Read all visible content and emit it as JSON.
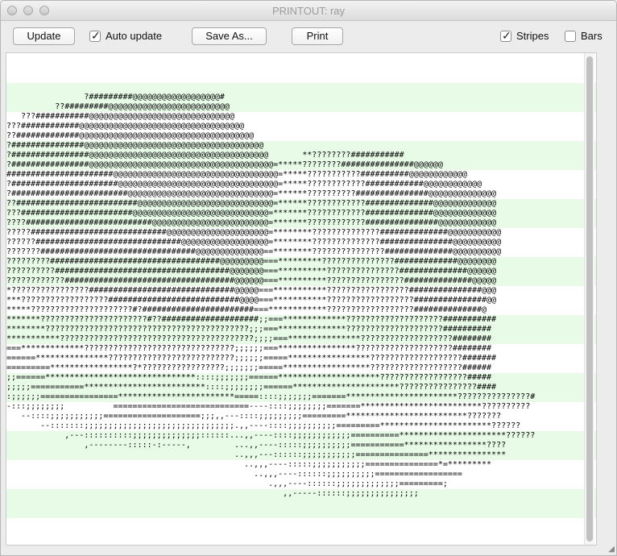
{
  "window": {
    "title": "PRINTOUT: ray"
  },
  "toolbar": {
    "update_label": "Update",
    "auto_update_label": "Auto update",
    "auto_update_checked": true,
    "save_as_label": "Save As...",
    "print_label": "Print",
    "stripes_label": "Stripes",
    "stripes_checked": true,
    "bars_label": "Bars",
    "bars_checked": false
  },
  "printout": {
    "lines": [
      "                ?#########@@@@@@@@@@@@@@@@@@#",
      "          ??#########@@@@@@@@@@@@@@@@@@@@@@@@@",
      "   ???###########@@@@@@@@@@@@@@@@@@@@@@@@@@@@@@",
      "???############@@@@@@@@@@@@@@@@@@@@@@@@@@@@@@@@@@",
      "??#############@@@@@@@@@@@@@@@@@@@@@@@@@@@@@@@@@@@@",
      "?###############@@@@@@@@@@@@@@@@@@@@@@@@@@@@@@@@@@@@@",
      "?################@@@@@@@@@@@@@@@@@@@@@@@@@@@@@@@@@@@@@       **????????###########",
      "?################@@@@@@@@@@@@@@@@@@@@@@@@@@@@@@@@@@@@@@=*****????????###############@@@@@@",
      "######################@@@@@@@@@@@@@@@@@@@@@@@@@@@@@@@@@@=*****???????????##########@@@@@@@@@@@@",
      "?######################@@@@@@@@@@@@@@@@@@@@@@@@@@@@@@@@@=*****????????????############@@@@@@@@@@@@",
      "?########################@@@@@@@@@@@@@@@@@@@@@@@@@@@@@@=******??????????###############@@@@@@@@@@@@@@",
      "??#########################@@@@@@@@@@@@@@@@@@@@@@@@@@@@=******????????????##############@@@@@@@@@@@@@",
      "???#######################@@@@@@@@@@@@@@@@@@@@@@@@@@@@=*******????????????##############@@@@@@@@@@@@@",
      "????##########################@@@@@@@@@@@@@@@@@@@@@@@@=*******????????????###############@@@@@@@@@@@@",
      "?????############################@@@@@@@@@@@@@@@@@@@@@=********??????????????##############@@@@@@@@@@@",
      "??????##############################@@@@@@@@@@@@@@@@@@=********??????????????###############@@@@@@@@@@",
      "???????################################@@@@@@@@@@@@@@==********???????????????##############@@@@@@@@@@",
      "?????????###################################@@@@@@@@@===*********???????????????#############@@@@@@@@",
      "??????????####################################@@@@@@@===**********???????????????##############@@@@@@",
      "????????????###################################@@@@@@===**********????????????????##############@@@@@",
      "*????????????????##############################@@@@@===***********?????????????????###############@@@",
      "***??????????????????###########################@@@@===***********??????????????????###############@@",
      "*****?????????????????????#?#######################===************??????????????????##############@",
      "*******??????????????????????#??####################;;===*************????????????????????###########",
      "********??????????????????????????????????????????;;;===**************????????????????????##########",
      "***********????????????????????????????????????????;;;;===***************???????????????????########",
      "===*************???????????????????????????????;;;;;;===****************????????????????????########",
      "======***************??????????????????????????;;;;;;=====*****************???????????????????#######",
      "=========*****************?*?????????????????;;;;;;;=====******************???????????????????######",
      ";;======*******************************::::;;;;;;;======*********************??????????????????#####",
      ";;;;;===========*************************::::;;;;;;;;======**********************????????????????####",
      ":;;;;;;================************************=====::::;;;;;;;=======***********************???????????????#",
      "-:::;;;;;;;;          ============================----::::;;;;;;;;=======*************************??????????",
      "   --::::;;;;;;;;;;;====================;;;,,---::::;;;;;;;;;=========*************************???????",
      "       --:::::::;;;;;;;;;;;;;;;;;;;;;;;;;;;;;;;.,,----::::;;;;;;;;;;=========***********************??????",
      "            ,---::::::::::;;;;;;;;;;;;;;::::::...,,----::::;;;;;;;;;;;;==========**********************??????",
      "                ,--------:::::-:-----,         ...,,----:::::;;;;;;;;;;===========*****************????",
      "                                               ..,,,---::::::;;;;;;;;;;;===============****************",
      "                                                 ..,,,----:::::;;;;;;;;;;;===============*=*********",
      "                                                   ..,,,----::::::;;;;;;;;;;==================",
      "                                                      .,,,----::::::;;;;;;;;;;;;;=========;",
      "                                                         ,,-----::::::;;;;;;;;;;;;;;;"
    ]
  }
}
